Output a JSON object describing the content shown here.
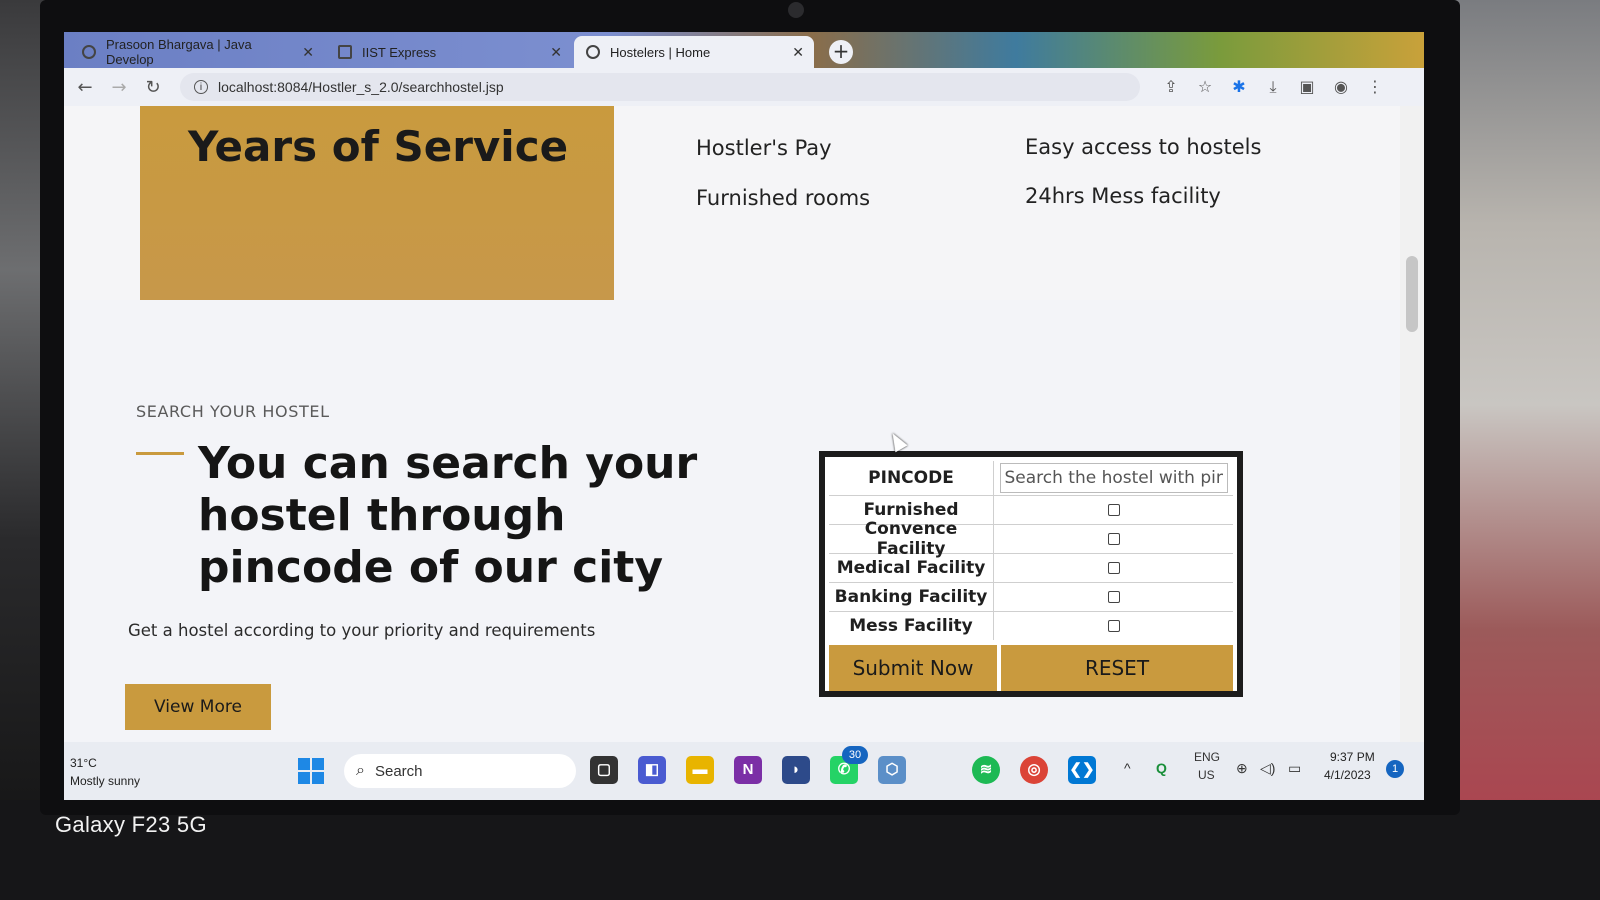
{
  "browser": {
    "tabs": [
      {
        "title": "Prasoon Bhargava | Java Develop",
        "close": "✕"
      },
      {
        "title": "IIST Express",
        "close": "✕"
      },
      {
        "title": "Hostelers | Home",
        "close": "✕"
      }
    ],
    "new_tab": "+",
    "url": "localhost:8084/Hostler_s_2.0/searchhostel.jsp"
  },
  "page": {
    "years_title": "Years of Service",
    "features": [
      "Hostler's Pay",
      "Easy access to hostels",
      "Furnished rooms",
      "24hrs Mess facility"
    ],
    "section_label": "SEARCH YOUR HOSTEL",
    "headline": "You can search your hostel through pincode of our city",
    "subtext": "Get a hostel according to your priority and requirements",
    "view_more": "View More",
    "form": {
      "pincode_label": "PINCODE",
      "pincode_placeholder": "Search the hostel with pincode",
      "pincode_value": "",
      "options": [
        {
          "label": "Furnished",
          "checked": false
        },
        {
          "label": "Convence Facility",
          "checked": false
        },
        {
          "label": "Medical Facility",
          "checked": false
        },
        {
          "label": "Banking Facility",
          "checked": false
        },
        {
          "label": "Mess Facility",
          "checked": false
        }
      ],
      "submit_label": "Submit Now",
      "reset_label": "RESET"
    }
  },
  "taskbar": {
    "weather_temp": "31°C",
    "weather_desc": "Mostly sunny",
    "search_label": "Search",
    "whatsapp_badge": "30",
    "lang_line1": "ENG",
    "lang_line2": "US",
    "time": "9:37 PM",
    "date": "4/1/2023",
    "notification_count": "1"
  },
  "device": {
    "phone_watermark": "Galaxy F23 5G"
  },
  "colors": {
    "accent_gold": "#c99a3e",
    "form_border": "#1c1c1c"
  }
}
